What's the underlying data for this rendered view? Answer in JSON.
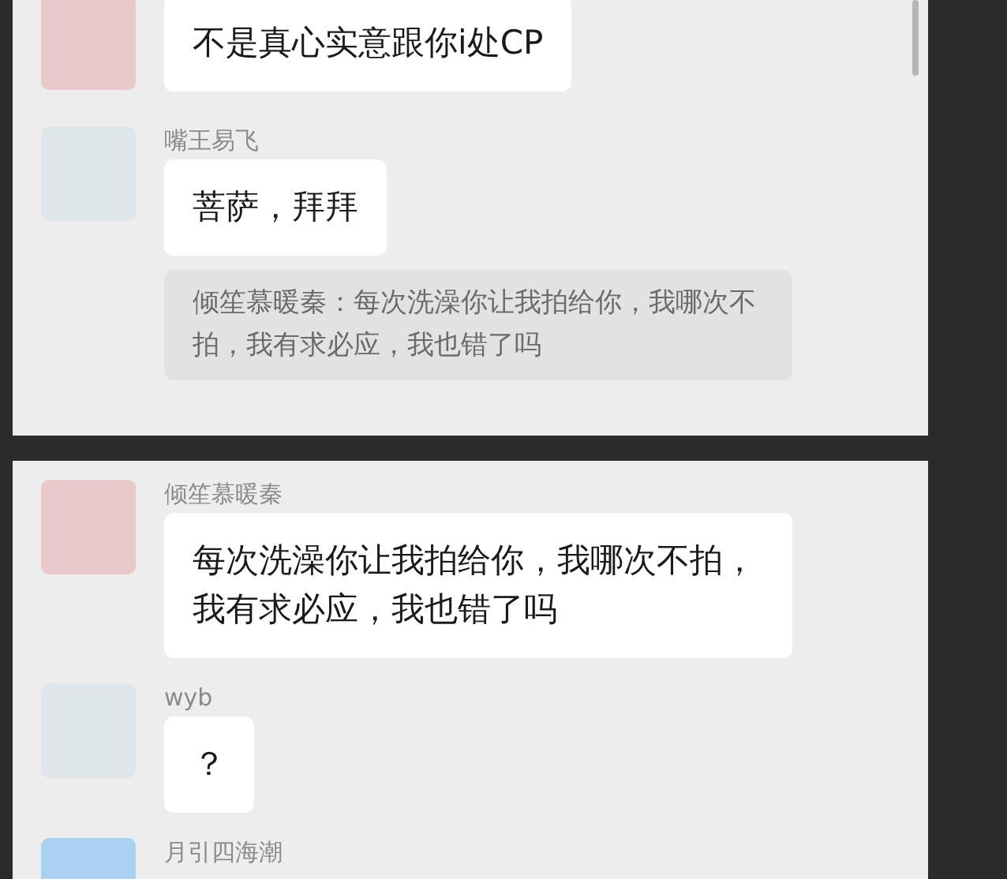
{
  "panels": [
    {
      "messages": [
        {
          "kind": "text",
          "text": "不是真心实意跟你i处CP"
        },
        {
          "kind": "text",
          "sender": "嘴王易飞",
          "text": "菩萨，拜拜",
          "quote": "倾笙慕暖秦：每次洗澡你让我拍给你，我哪次不拍，我有求必应，我也错了吗"
        }
      ]
    },
    {
      "messages": [
        {
          "kind": "text",
          "sender": "倾笙慕暖秦",
          "text": "每次洗澡你让我拍给你，我哪次不拍，我有求必应，我也错了吗"
        },
        {
          "kind": "text",
          "sender": "wyb",
          "text": "？"
        },
        {
          "kind": "partial",
          "sender": "月引四海潮"
        }
      ]
    }
  ]
}
